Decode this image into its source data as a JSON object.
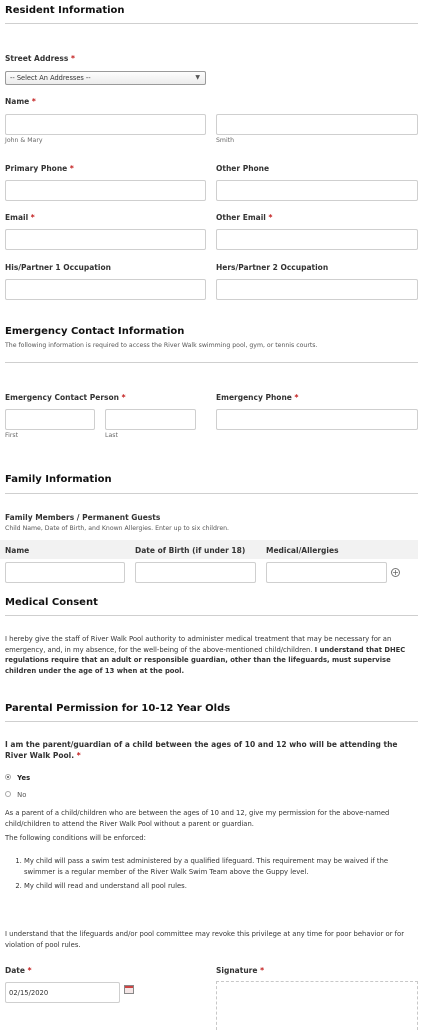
{
  "sections": {
    "resident": "Resident Information",
    "emergency": "Emergency Contact Information",
    "emergency_desc": "The following information is required to access the River Walk swimming pool, gym, or tennis courts.",
    "family": "Family Information",
    "medical": "Medical Consent",
    "parental": "Parental Permission for 10-12 Year Olds"
  },
  "resident": {
    "street_label": "Street Address",
    "street_value": "-- Select An Addresses --",
    "name_label": "Name",
    "first_sub": "John & Mary",
    "last_sub": "Smith",
    "primary_phone": "Primary Phone",
    "other_phone": "Other Phone",
    "email": "Email",
    "other_email": "Other Email",
    "occupation1": "His/Partner 1 Occupation",
    "occupation2": "Hers/Partner 2 Occupation"
  },
  "emergency": {
    "person_label": "Emergency Contact Person",
    "phone_label": "Emergency Phone",
    "first_sub": "First",
    "last_sub": "Last"
  },
  "family": {
    "members_label": "Family Members / Permanent Guests",
    "members_desc": "Child Name, Date of Birth, and Known Allergies. Enter up to six children.",
    "col_name": "Name",
    "col_dob": "Date of Birth (if under 18)",
    "col_medical": "Medical/Allergies"
  },
  "medical": {
    "text_plain": "I hereby give the staff of River Walk Pool authority to administer medical treatment that may be necessary for an emergency, and, in my absence, for the well-being of the above-mentioned child/children.",
    "text_bold": "I understand that DHEC regulations require that an adult or responsible guardian, other than the lifeguards, must supervise children under the age of 13 when at the pool."
  },
  "parental": {
    "question": "I am the parent/guardian of a child between the ages of 10 and 12 who will be attending the River Walk Pool.",
    "yes": "Yes",
    "no": "No",
    "para1": "As a parent of a child/children who are between the ages of 10 and 12, give my permission for the above-named child/children to attend the River Walk Pool without a parent or guardian.",
    "para2": "The following conditions will be enforced:",
    "item1": "My child will pass a swim test administered by a qualified lifeguard. This requirement may be waived if the swimmer is a regular member of the River Walk Swim Team above the Guppy level.",
    "item2": "My child will read and understand all pool rules.",
    "revoke": "I understand that the lifeguards and/or pool committee may revoke this privilege at any time for poor behavior or for violation of pool rules.",
    "date_label": "Date",
    "date_value": "02/15/2020",
    "signature_label": "Signature"
  },
  "required_mark": "*",
  "colors": {
    "required": "#c21b1b",
    "rule": "#cfcfcf",
    "table_header_bg": "#f2f2f2"
  }
}
